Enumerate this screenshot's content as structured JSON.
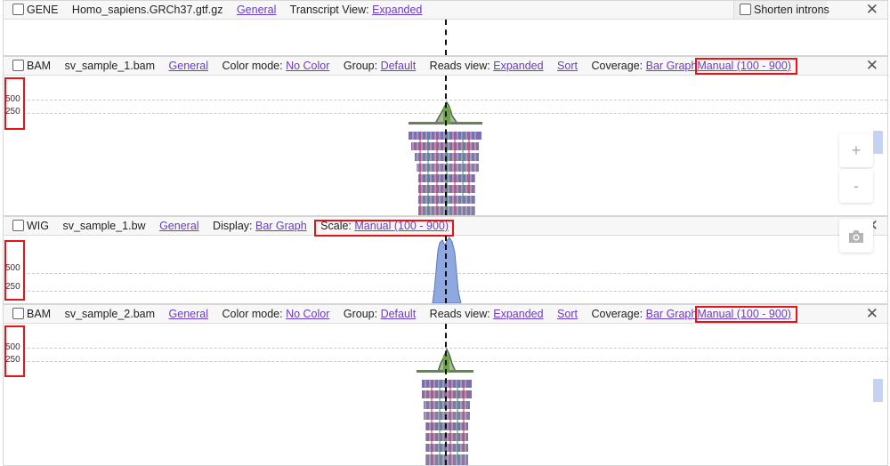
{
  "gene": {
    "type": "GENE",
    "file": "Homo_sapiens.GRCh37.gtf.gz",
    "general": "General",
    "transcript_label": "Transcript View:",
    "transcript_value": "Expanded",
    "shorten": "Shorten introns"
  },
  "bam1": {
    "type": "BAM",
    "file": "sv_sample_1.bam",
    "general": "General",
    "color_label": "Color mode:",
    "color_value": "No Color",
    "group_label": "Group:",
    "group_value": "Default",
    "reads_label": "Reads view:",
    "reads_value": "Expanded",
    "sort": "Sort",
    "coverage_label": "Coverage:",
    "coverage_value": "Bar Graph",
    "scale_value": "Manual (100 - 900)",
    "tick_hi": "500",
    "tick_lo": "250"
  },
  "wig": {
    "type": "WIG",
    "file": "sv_sample_1.bw",
    "general": "General",
    "display_label": "Display:",
    "display_value": "Bar Graph",
    "scale_label": "Scale:",
    "scale_value": "Manual (100 - 900)",
    "tick_hi": "500",
    "tick_lo": "250"
  },
  "bam2": {
    "type": "BAM",
    "file": "sv_sample_2.bam",
    "general": "General",
    "color_label": "Color mode:",
    "color_value": "No Color",
    "group_label": "Group:",
    "group_value": "Default",
    "reads_label": "Reads view:",
    "reads_value": "Expanded",
    "sort": "Sort",
    "coverage_label": "Coverage:",
    "coverage_value": "Bar Graph",
    "scale_value": "Manual (100 - 900)",
    "tick_hi": "500",
    "tick_lo": "250"
  },
  "controls": {
    "zoom_in": "+",
    "zoom_out": "-"
  },
  "close_symbol": "✕",
  "colors": {
    "link": "#6a3cc7",
    "highlight": "#e11111",
    "wig_fill": "#8fa9e0",
    "coverage_fill": "#6b8e4e"
  },
  "icons": [
    "close-icon",
    "camera-icon",
    "zoom-in-icon",
    "zoom-out-icon"
  ]
}
